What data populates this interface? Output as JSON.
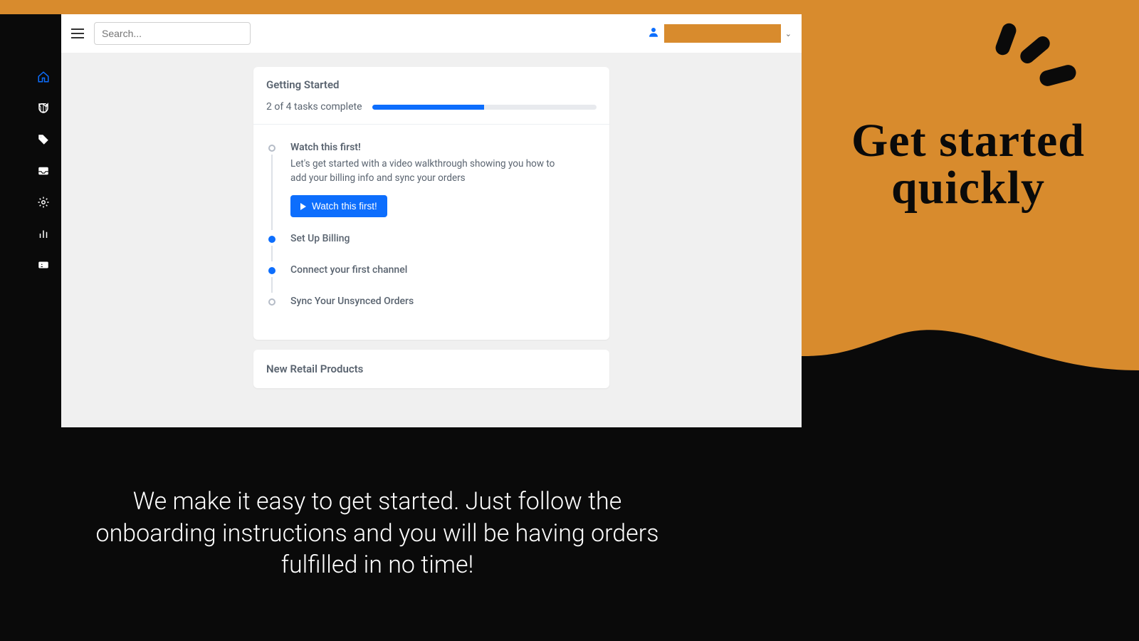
{
  "promo": {
    "heading": "Get started quickly",
    "caption": "We make it easy to get started. Just follow the onboarding instructions and you will be having orders fulfilled in no time!"
  },
  "topbar": {
    "search_placeholder": "Search..."
  },
  "getting_started": {
    "title": "Getting Started",
    "progress_text": "2 of 4 tasks complete",
    "progress_percent": 50,
    "tasks": [
      {
        "title": "Watch this first!",
        "desc": "Let's get started with a video walkthrough showing you how to add your billing info and sync your orders",
        "button_label": "Watch this first!",
        "completed": false
      },
      {
        "title": "Set Up Billing",
        "completed": true
      },
      {
        "title": "Connect your first channel",
        "completed": true
      },
      {
        "title": "Sync Your Unsynced Orders",
        "completed": false
      }
    ]
  },
  "secondary_card": {
    "title": "New Retail Products"
  },
  "sidebar": {
    "items": [
      {
        "name": "home",
        "active": true
      },
      {
        "name": "products"
      },
      {
        "name": "tags"
      },
      {
        "name": "inbox"
      },
      {
        "name": "settings"
      },
      {
        "name": "analytics"
      },
      {
        "name": "id-card"
      }
    ]
  }
}
